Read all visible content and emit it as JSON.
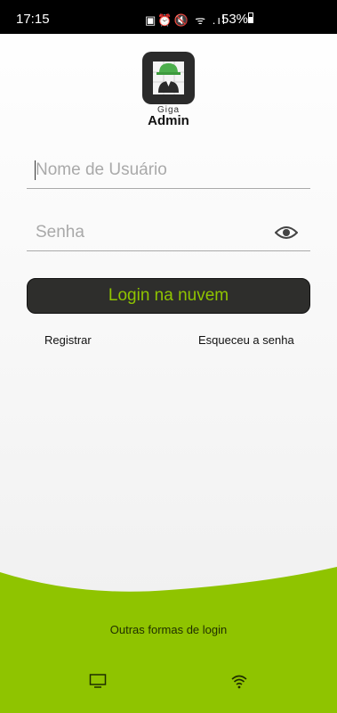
{
  "status_bar": {
    "time": "17:15",
    "battery": "53%"
  },
  "logo": {
    "brand": "Giga",
    "product": "Admin"
  },
  "form": {
    "username_placeholder": "Nome de Usuário",
    "password_placeholder": "Senha",
    "login_button": "Login na nuvem"
  },
  "links": {
    "register": "Registrar",
    "forgot_password": "Esqueceu a senha"
  },
  "footer": {
    "other_login": "Outras formas de login"
  },
  "colors": {
    "accent_green": "#8fc400",
    "button_dark": "#2e2e2c"
  },
  "icons": [
    "status-icons",
    "eye-icon",
    "monitor-icon",
    "wifi-icon"
  ]
}
